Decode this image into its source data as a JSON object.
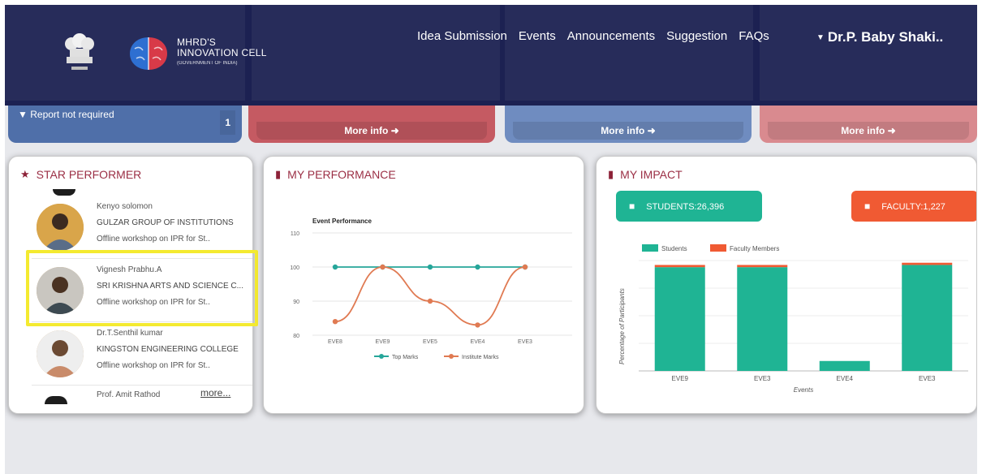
{
  "nav": {
    "brand_line1": "MHRD'S",
    "brand_line2": "INNOVATION CELL",
    "brand_line3": "(GOVERNMENT OF INDIA)",
    "links": [
      "Idea Submission",
      "Events",
      "Announcements",
      "Suggestion",
      "FAQs"
    ],
    "user": "Dr.P. Baby Shaki.."
  },
  "tiles": {
    "report_label": "Report not required",
    "report_count": "1",
    "more_info": "More info"
  },
  "star_performer": {
    "title": "STAR PERFORMER",
    "performers": [
      {
        "name": "Kenyo solomon",
        "institute": "GULZAR GROUP OF INSTITUTIONS",
        "workshop": "Offline workshop on IPR for St.."
      },
      {
        "name": "Vignesh Prabhu.A",
        "institute": "SRI KRISHNA ARTS AND SCIENCE C...",
        "workshop": "Offline workshop on IPR for St.."
      },
      {
        "name": "Dr.T.Senthil kumar",
        "institute": "KINGSTON ENGINEERING COLLEGE",
        "workshop": "Offline workshop on IPR for St.."
      }
    ],
    "last_name": "Prof. Amit Rathod",
    "more": "more..."
  },
  "my_performance": {
    "title": "MY PERFORMANCE"
  },
  "my_impact": {
    "title": "MY IMPACT",
    "students": "STUDENTS:26,396",
    "faculty": "FACULTY:1,227"
  },
  "colors": {
    "header": "#1c2152",
    "accent": "#9b2f45",
    "teal": "#1fb494",
    "orange": "#f05a33",
    "highlight": "#f4ea30"
  },
  "chart_data": [
    {
      "type": "line",
      "title": "Event Performance",
      "categories": [
        "EVE8",
        "EVE9",
        "EVE5",
        "EVE4",
        "EVE3"
      ],
      "ylim": [
        80,
        110
      ],
      "yticks": [
        80,
        90,
        100,
        110
      ],
      "series": [
        {
          "name": "Top Marks",
          "color": "#26a69a",
          "values": [
            100,
            100,
            100,
            100,
            100
          ]
        },
        {
          "name": "Institute Marks",
          "color": "#e07a52",
          "values": [
            84,
            100,
            90,
            83,
            100
          ]
        }
      ],
      "legend": "bottom",
      "grid": true
    },
    {
      "type": "bar",
      "stacked": true,
      "categories": [
        "EVE9",
        "EVE3",
        "EVE4",
        "EVE3"
      ],
      "xlabel": "Events",
      "ylabel": "Percentage of Participants",
      "ylim": [
        0,
        100
      ],
      "series": [
        {
          "name": "Students",
          "color": "#1fb494",
          "values": [
            94,
            94,
            9,
            96
          ]
        },
        {
          "name": "Faculty Members",
          "color": "#f05a33",
          "values": [
            2,
            2,
            0,
            2
          ]
        }
      ],
      "legend": "top",
      "grid": true
    }
  ]
}
